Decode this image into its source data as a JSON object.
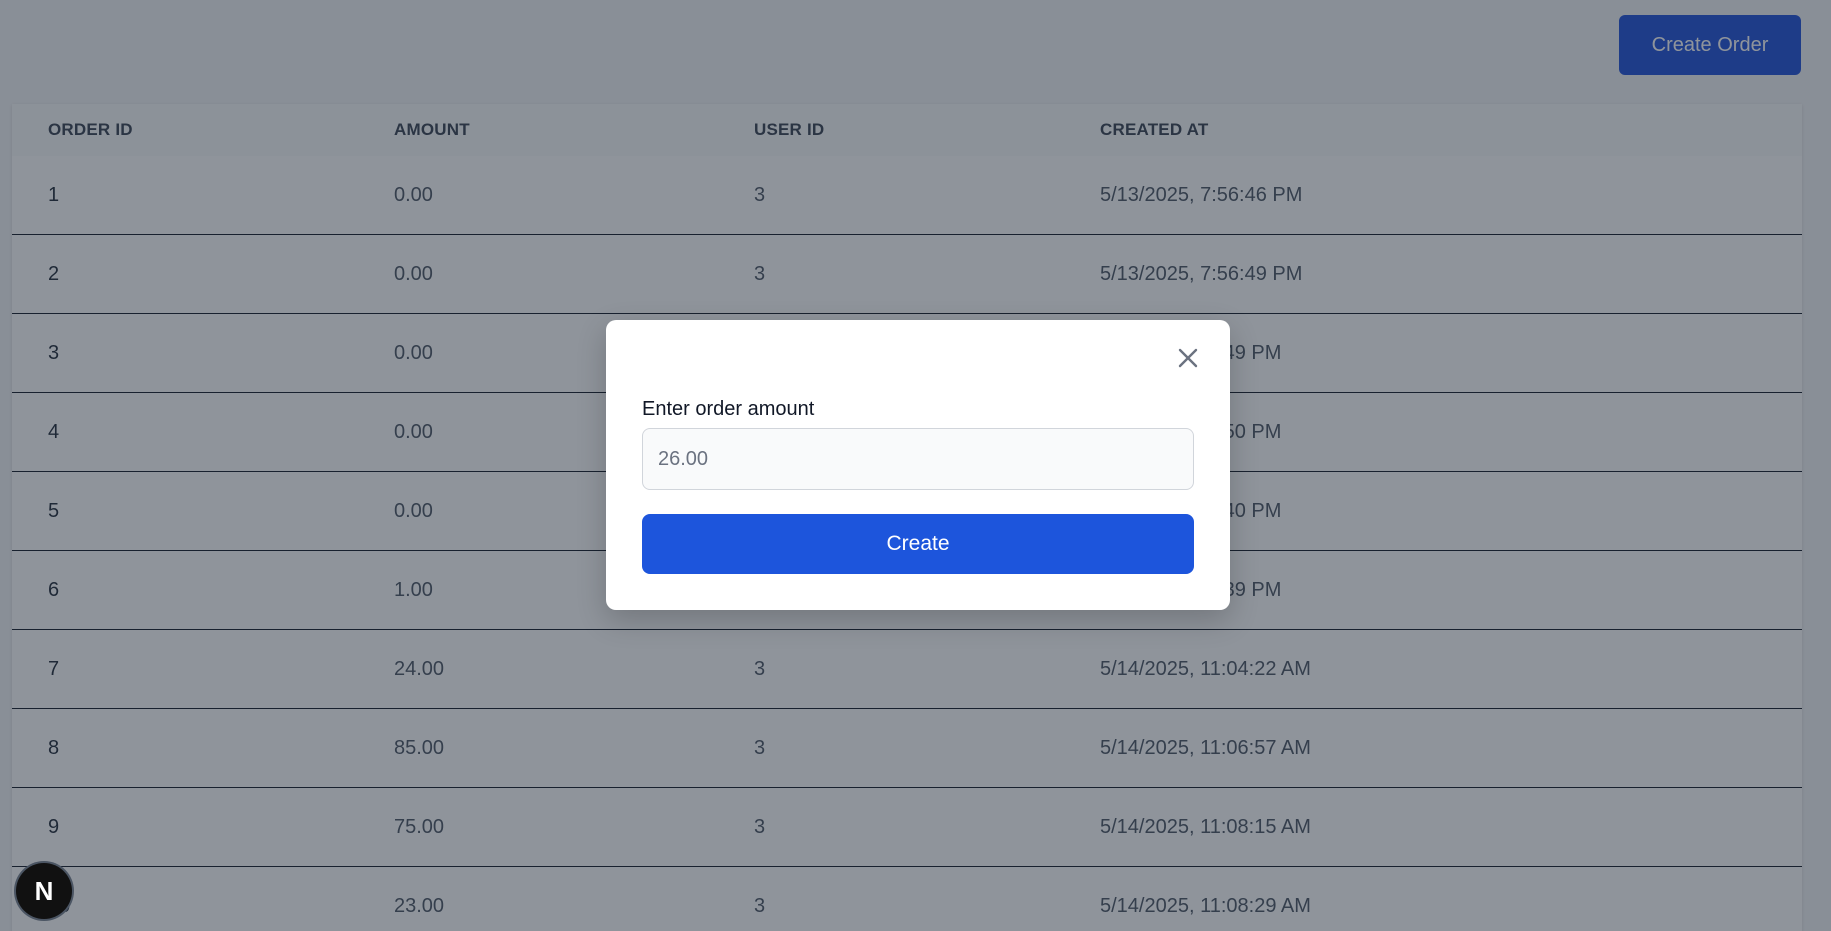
{
  "header": {
    "create_order_label": "Create Order"
  },
  "table": {
    "columns": [
      "ORDER ID",
      "AMOUNT",
      "USER ID",
      "CREATED AT"
    ],
    "rows": [
      {
        "order_id": "1",
        "amount": "0.00",
        "user_id": "3",
        "created_at": "5/13/2025, 7:56:46 PM"
      },
      {
        "order_id": "2",
        "amount": "0.00",
        "user_id": "3",
        "created_at": "5/13/2025, 7:56:49 PM"
      },
      {
        "order_id": "3",
        "amount": "0.00",
        "user_id": "",
        "created_at": ", 7:56:49 PM"
      },
      {
        "order_id": "4",
        "amount": "0.00",
        "user_id": "",
        "created_at": ", 7:56:50 PM"
      },
      {
        "order_id": "5",
        "amount": "0.00",
        "user_id": "",
        "created_at": ", 8:18:40 PM"
      },
      {
        "order_id": "6",
        "amount": "1.00",
        "user_id": "",
        "created_at": ", 8:19:39 PM"
      },
      {
        "order_id": "7",
        "amount": "24.00",
        "user_id": "3",
        "created_at": "5/14/2025, 11:04:22 AM"
      },
      {
        "order_id": "8",
        "amount": "85.00",
        "user_id": "3",
        "created_at": "5/14/2025, 11:06:57 AM"
      },
      {
        "order_id": "9",
        "amount": "75.00",
        "user_id": "3",
        "created_at": "5/14/2025, 11:08:15 AM"
      },
      {
        "order_id": "10",
        "amount": "23.00",
        "user_id": "3",
        "created_at": "5/14/2025, 11:08:29 AM"
      }
    ]
  },
  "modal": {
    "label": "Enter order amount",
    "amount_value": "26.00",
    "create_label": "Create",
    "close_icon": "close-icon"
  },
  "badge": {
    "text": "N",
    "icon": "nextjs-logo-icon"
  },
  "colors": {
    "primary": "#1d55dc",
    "overlay": "rgba(31, 41, 55, 0.5)"
  }
}
